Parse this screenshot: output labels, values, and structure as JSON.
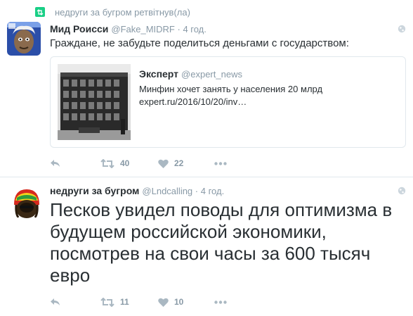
{
  "tweet1": {
    "retweet_context": "недруги за бугром ретвітнув(ла)",
    "name": "Мид Роисси",
    "handle": "@Fake_MIDRF",
    "time": "· 4 год.",
    "text": "Граждане, не забудьте поделиться деньгами с государством:",
    "quote": {
      "name": "Эксперт",
      "handle": "@expert_news",
      "text": "Минфин хочет занять у населения 20 млрд",
      "link": "expert.ru/2016/10/20/inv…"
    },
    "retweets": "40",
    "likes": "22"
  },
  "tweet2": {
    "name": "недруги за бугром",
    "handle": "@Lndcalling",
    "time": "· 4 год.",
    "text": "Песков увидел поводы для оптимизма в будущем российской экономики, посмотрев на свои часы за 600 тысяч евро",
    "retweets": "11",
    "likes": "10"
  },
  "colors": {
    "retweet_green": "#19cf86",
    "secondary_text": "#8899a6",
    "border": "#e1e8ed",
    "action_icon": "#aab8c2"
  },
  "icons": [
    "retweet-context-icon",
    "globe-icon",
    "reply-icon",
    "retweet-icon",
    "heart-icon",
    "more-icon"
  ]
}
